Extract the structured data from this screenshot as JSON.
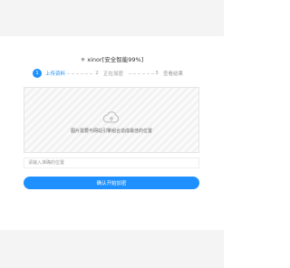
{
  "header": {
    "title": "xinor[安全智能99%]",
    "title_icon": "sparkle-icon"
  },
  "steps": [
    {
      "number": "1",
      "label": "上传资料",
      "active": true
    },
    {
      "number": "2",
      "label": "正在加密",
      "active": false
    },
    {
      "number": "3",
      "label": "查看结果",
      "active": false
    }
  ],
  "upload": {
    "icon": "cloud-upload-icon",
    "hint": "图片需要与网站引擎组合造成最佳的位置"
  },
  "position_input": {
    "value": "",
    "placeholder": "请输入准确的位置"
  },
  "confirm_button": {
    "label": "确认开始加密"
  },
  "colors": {
    "accent": "#1e90ff",
    "background": "#f4f4f4",
    "card": "#ffffff"
  }
}
